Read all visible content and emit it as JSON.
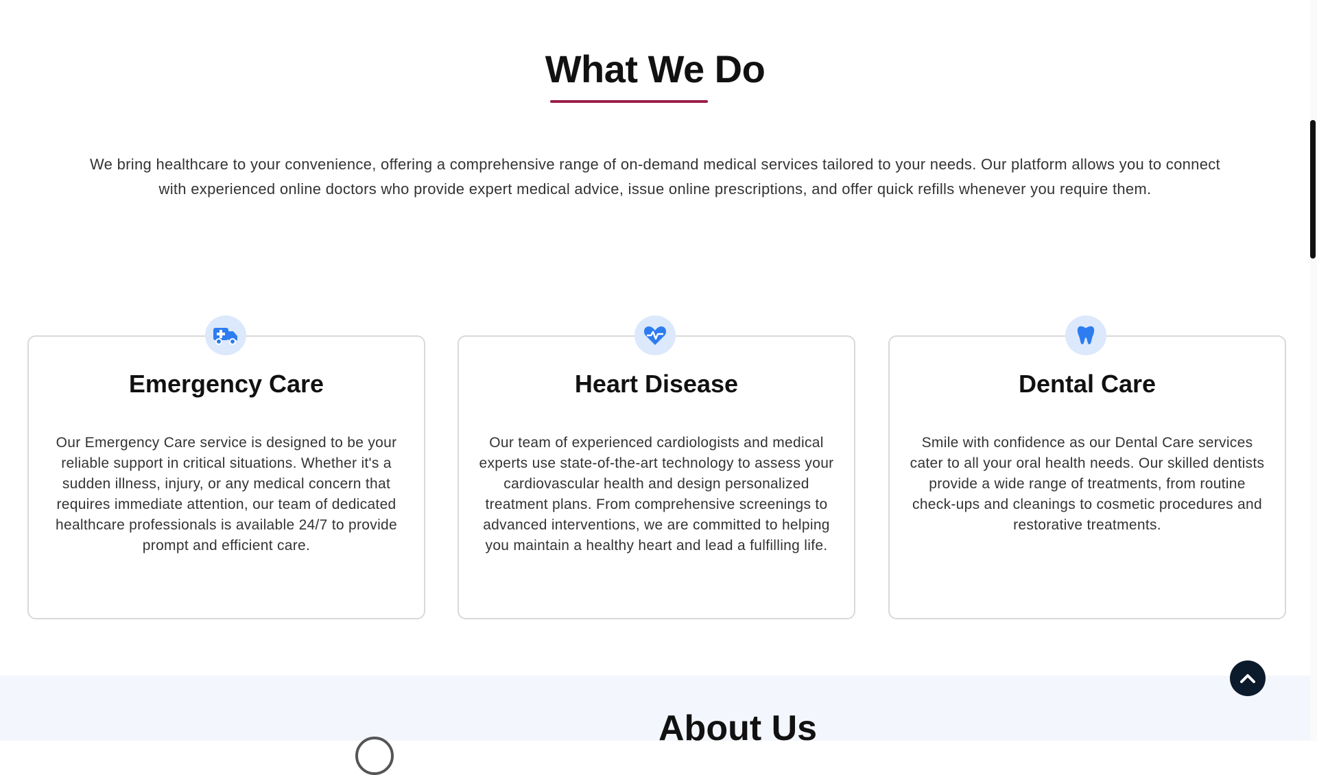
{
  "what_we_do": {
    "title": "What We Do",
    "intro": "We bring healthcare to your convenience, offering a comprehensive range of on-demand medical services tailored to your needs. Our platform allows you to connect with experienced online doctors who provide expert medical advice, issue online prescriptions, and offer quick refills whenever you require them.",
    "accent_color": "#9b1d4a"
  },
  "services": [
    {
      "icon": "ambulance-icon",
      "title": "Emergency Care",
      "body": "Our Emergency Care service is designed to be your reliable support in critical situations. Whether it's a sudden illness, injury, or any medical concern that requires immediate attention, our team of dedicated healthcare professionals is available 24/7 to provide prompt and efficient care."
    },
    {
      "icon": "heartbeat-icon",
      "title": "Heart Disease",
      "body": "Our team of experienced cardiologists and medical experts use state-of-the-art technology to assess your cardiovascular health and design personalized treatment plans. From comprehensive screenings to advanced interventions, we are committed to helping you maintain a healthy heart and lead a fulfilling life."
    },
    {
      "icon": "tooth-icon",
      "title": "Dental Care",
      "body": "Smile with confidence as our Dental Care services cater to all your oral health needs. Our skilled dentists provide a wide range of treatments, from routine check-ups and cleanings to cosmetic procedures and restorative treatments."
    }
  ],
  "icon_color": "#2d7cf0",
  "icon_bg": "#dce8fb",
  "about": {
    "title": "About Us",
    "band_color": "#f3f6fd"
  },
  "scroll_top": {
    "icon": "chevron-up-icon",
    "bg": "#0c1b2c"
  }
}
